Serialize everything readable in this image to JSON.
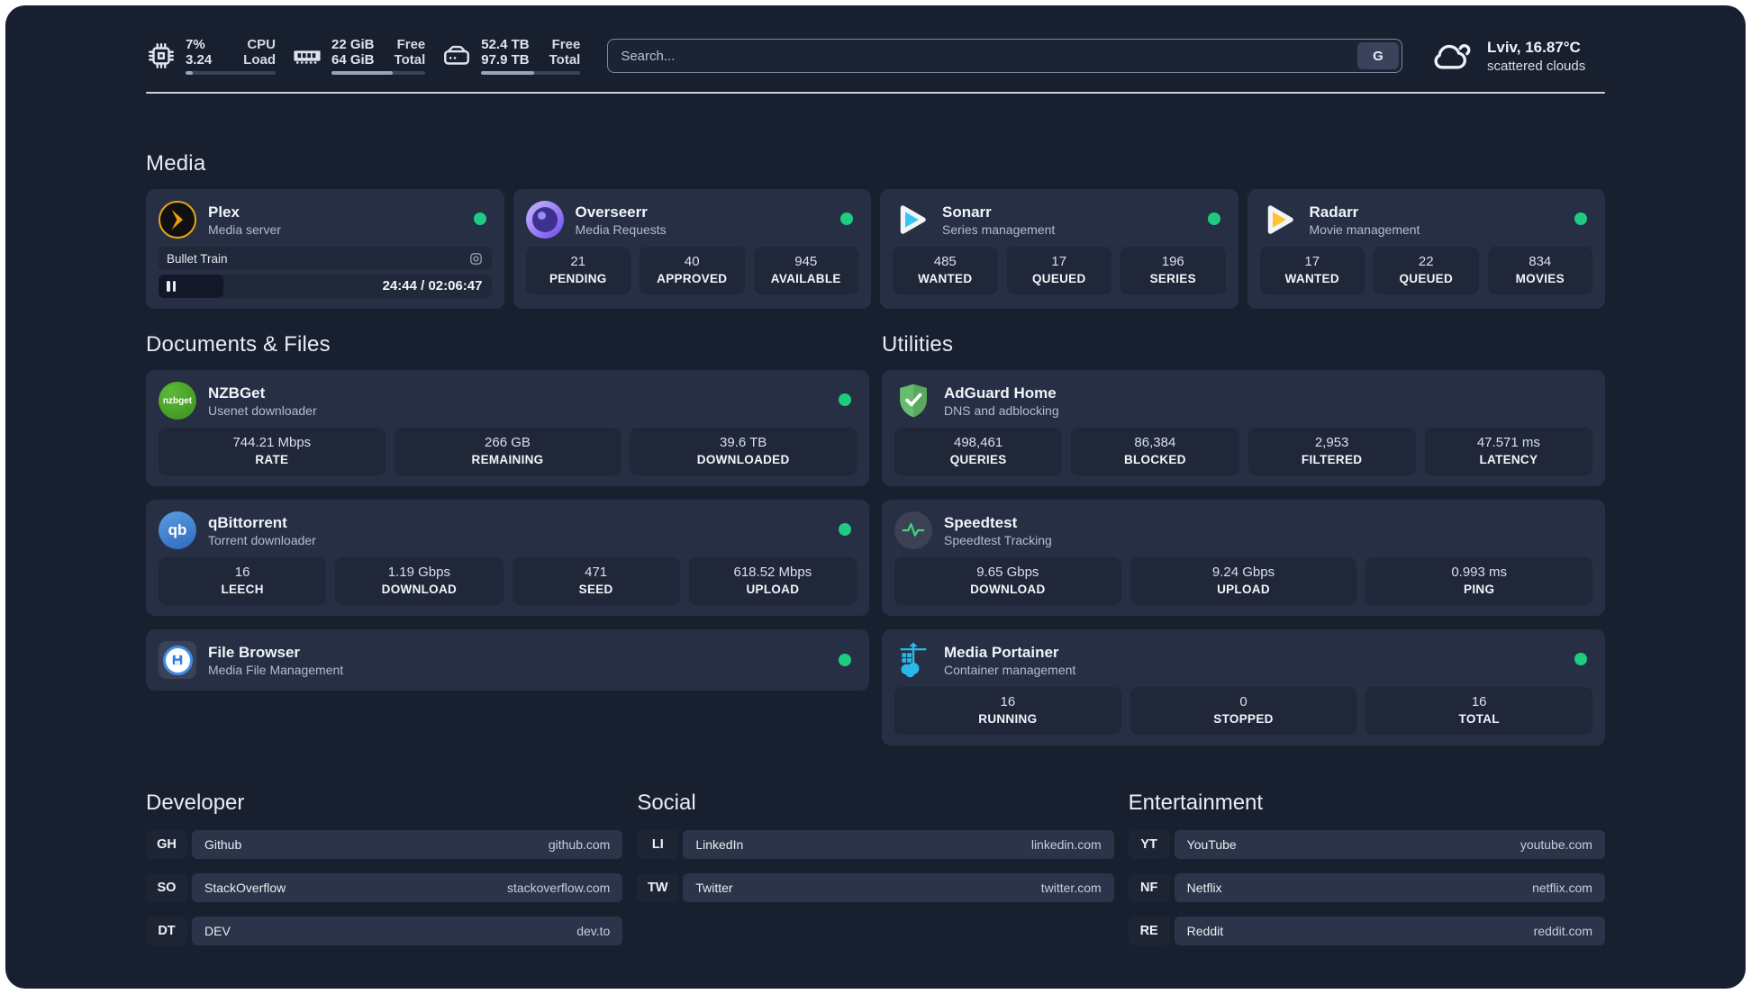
{
  "header": {
    "stats": {
      "cpu": {
        "line1": "7%",
        "line2": "3.24",
        "label1": "CPU",
        "label2": "Load",
        "progress_pct": 8
      },
      "memory": {
        "line1": "22 GiB",
        "line2": "64 GiB",
        "label1": "Free",
        "label2": "Total",
        "progress_pct": 65
      },
      "storage": {
        "line1": "52.4 TB",
        "line2": "97.9 TB",
        "label1": "Free",
        "label2": "Total",
        "progress_pct": 53
      }
    },
    "search": {
      "placeholder": "Search...",
      "engine_button_label": "G"
    },
    "weather": {
      "location": "Lviv, 16.87°C",
      "condition": "scattered clouds"
    }
  },
  "sections": {
    "media": {
      "title": "Media",
      "apps": {
        "plex": {
          "name": "Plex",
          "description": "Media server",
          "now_playing": {
            "title": "Bullet Train",
            "time_display": "24:44 / 02:06:47",
            "progress_pct": 19.5
          }
        },
        "overseerr": {
          "name": "Overseerr",
          "description": "Media Requests",
          "stats": [
            {
              "value": "21",
              "label": "PENDING"
            },
            {
              "value": "40",
              "label": "APPROVED"
            },
            {
              "value": "945",
              "label": "AVAILABLE"
            }
          ]
        },
        "sonarr": {
          "name": "Sonarr",
          "description": "Series management",
          "stats": [
            {
              "value": "485",
              "label": "WANTED"
            },
            {
              "value": "17",
              "label": "QUEUED"
            },
            {
              "value": "196",
              "label": "SERIES"
            }
          ]
        },
        "radarr": {
          "name": "Radarr",
          "description": "Movie management",
          "stats": [
            {
              "value": "17",
              "label": "WANTED"
            },
            {
              "value": "22",
              "label": "QUEUED"
            },
            {
              "value": "834",
              "label": "MOVIES"
            }
          ]
        }
      }
    },
    "documents": {
      "title": "Documents & Files",
      "apps": {
        "nzbget": {
          "name": "NZBGet",
          "description": "Usenet downloader",
          "stats": [
            {
              "value": "744.21 Mbps",
              "label": "RATE"
            },
            {
              "value": "266 GB",
              "label": "REMAINING"
            },
            {
              "value": "39.6 TB",
              "label": "DOWNLOADED"
            }
          ]
        },
        "qbittorrent": {
          "name": "qBittorrent",
          "description": "Torrent downloader",
          "stats": [
            {
              "value": "16",
              "label": "LEECH"
            },
            {
              "value": "1.19 Gbps",
              "label": "DOWNLOAD"
            },
            {
              "value": "471",
              "label": "SEED"
            },
            {
              "value": "618.52 Mbps",
              "label": "UPLOAD"
            }
          ]
        },
        "filebrowser": {
          "name": "File Browser",
          "description": "Media File Management"
        }
      }
    },
    "utilities": {
      "title": "Utilities",
      "apps": {
        "adguard": {
          "name": "AdGuard Home",
          "description": "DNS and adblocking",
          "stats": [
            {
              "value": "498,461",
              "label": "QUERIES"
            },
            {
              "value": "86,384",
              "label": "BLOCKED"
            },
            {
              "value": "2,953",
              "label": "FILTERED"
            },
            {
              "value": "47.571 ms",
              "label": "LATENCY"
            }
          ]
        },
        "speedtest": {
          "name": "Speedtest",
          "description": "Speedtest Tracking",
          "stats": [
            {
              "value": "9.65 Gbps",
              "label": "DOWNLOAD"
            },
            {
              "value": "9.24 Gbps",
              "label": "UPLOAD"
            },
            {
              "value": "0.993 ms",
              "label": "PING"
            }
          ]
        },
        "portainer": {
          "name": "Media Portainer",
          "description": "Container management",
          "stats": [
            {
              "value": "16",
              "label": "RUNNING"
            },
            {
              "value": "0",
              "label": "STOPPED"
            },
            {
              "value": "16",
              "label": "TOTAL"
            }
          ]
        }
      }
    }
  },
  "links": {
    "developer": {
      "title": "Developer",
      "items": [
        {
          "abbr": "GH",
          "name": "Github",
          "url": "github.com"
        },
        {
          "abbr": "SO",
          "name": "StackOverflow",
          "url": "stackoverflow.com"
        },
        {
          "abbr": "DT",
          "name": "DEV",
          "url": "dev.to"
        }
      ]
    },
    "social": {
      "title": "Social",
      "items": [
        {
          "abbr": "LI",
          "name": "LinkedIn",
          "url": "linkedin.com"
        },
        {
          "abbr": "TW",
          "name": "Twitter",
          "url": "twitter.com"
        }
      ]
    },
    "entertainment": {
      "title": "Entertainment",
      "items": [
        {
          "abbr": "YT",
          "name": "YouTube",
          "url": "youtube.com"
        },
        {
          "abbr": "NF",
          "name": "Netflix",
          "url": "netflix.com"
        },
        {
          "abbr": "RE",
          "name": "Reddit",
          "url": "reddit.com"
        }
      ]
    }
  },
  "colors": {
    "status_online": "#1ecb81",
    "page_background": "#182030",
    "card_background": "#262f44",
    "plex_accent": "#e6a716",
    "sonarr_accent": "#35c5f4",
    "radarr_accent": "#ffc230"
  }
}
